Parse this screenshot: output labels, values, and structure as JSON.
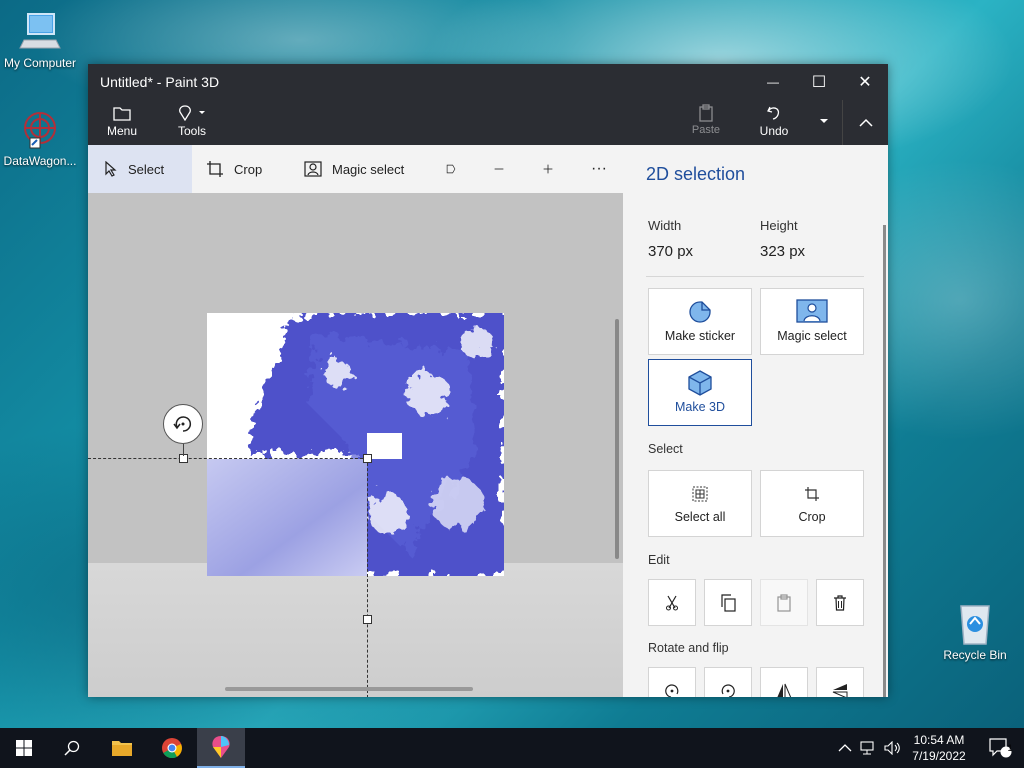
{
  "desktop": {
    "icons": [
      {
        "label": "My Computer"
      },
      {
        "label": "DataWagon..."
      },
      {
        "label": "Recycle Bin"
      }
    ]
  },
  "window": {
    "title": "Untitled* - Paint 3D",
    "controls": {
      "minimize": "—",
      "maximize": "☐",
      "close": "✕"
    }
  },
  "ribbon": {
    "menu": "Menu",
    "tools": "Tools",
    "paste": "Paste",
    "undo": "Undo"
  },
  "toolbar": {
    "select": "Select",
    "crop": "Crop",
    "magic_select": "Magic select",
    "more": "···"
  },
  "side_panel": {
    "heading": "2D selection",
    "width_label": "Width",
    "width_value": "370 px",
    "height_label": "Height",
    "height_value": "323 px",
    "make_sticker": "Make sticker",
    "magic_select": "Magic select",
    "make_3d": "Make 3D",
    "select_section": "Select",
    "select_all": "Select all",
    "crop": "Crop",
    "edit_section": "Edit",
    "rotate_flip_section": "Rotate and flip"
  },
  "taskbar": {
    "time": "10:54 AM",
    "date": "7/19/2022",
    "notification_count": "1"
  },
  "colors": {
    "accent": "#1f4e9c",
    "titlebar": "#2b2d33",
    "paint_blue": "#3a3fc4"
  }
}
